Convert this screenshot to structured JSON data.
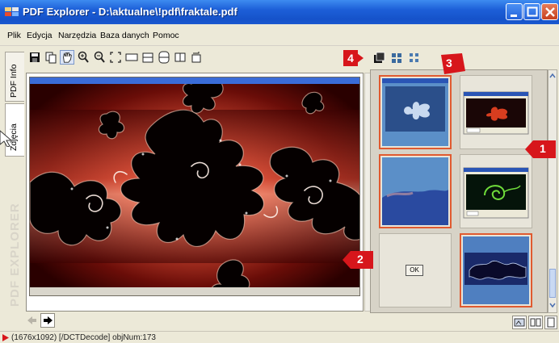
{
  "window": {
    "title": "PDF Explorer - D:\\aktualne\\!pdf\\fraktale.pdf"
  },
  "menu": {
    "items": [
      "Plik",
      "Edycja",
      "Narzędzia",
      "Baza danych",
      "Pomoc"
    ]
  },
  "left_tabs": {
    "tabs": [
      "PDF Info",
      "Zdjęcia"
    ],
    "watermark": "PDF EXPLORER"
  },
  "thumbnail_panel": {
    "ok_button_label": "OK",
    "thumbnails": [
      "thumb-1",
      "thumb-2",
      "thumb-3",
      "thumb-4",
      "thumb-5",
      "thumb-6"
    ]
  },
  "annotations": {
    "badges": [
      "1",
      "2",
      "3",
      "4"
    ]
  },
  "status": {
    "text": "(1676x1092) [/DCTDecode] objNum:173"
  },
  "colors": {
    "title_bar": "#1d5fd8",
    "selection_border": "#e05a30",
    "badge_red": "#d7161b",
    "thumbnail_blue": "#5b8fc8"
  }
}
